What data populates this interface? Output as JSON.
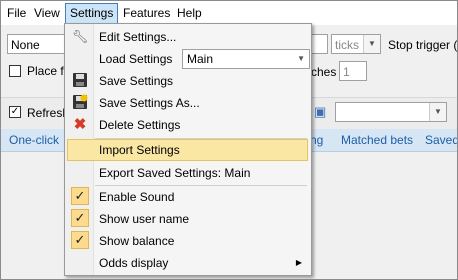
{
  "menubar": {
    "items": [
      "File",
      "View",
      "Settings",
      "Features",
      "Help"
    ]
  },
  "background": {
    "profile_combo": "None",
    "place_fill_label": "Place fi",
    "refresh_label": "Refresh",
    "ticks_label": "ticks",
    "stop_trigger_label": "Stop trigger (",
    "matches_label": "ches",
    "matches_value": "1",
    "tabs": [
      "One-click",
      "ng",
      "Matched bets",
      "Saved"
    ]
  },
  "settings_menu": {
    "edit": "Edit Settings...",
    "load": "Load Settings",
    "load_value": "Main",
    "save": "Save Settings",
    "save_as": "Save Settings As...",
    "delete": "Delete Settings",
    "import": "Import Settings",
    "export": "Export Saved Settings: Main",
    "enable_sound": "Enable Sound",
    "show_user": "Show user name",
    "show_balance": "Show balance",
    "odds_display": "Odds display"
  },
  "colors": {
    "highlight": "#fbe7a4",
    "checked_bg": "#fcdb8e",
    "tab_text": "#1d5ea8"
  }
}
